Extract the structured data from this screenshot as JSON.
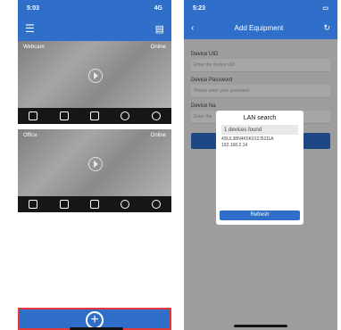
{
  "left": {
    "status_time": "5:03",
    "status_right": "4G",
    "cameras": [
      {
        "name": "Webcam",
        "status": "Online"
      },
      {
        "name": "Office",
        "status": "Online"
      }
    ]
  },
  "right": {
    "status_time": "5:23",
    "title": "Add Equipment",
    "fields": [
      {
        "label": "Device UID",
        "placeholder": "Enter the device UID"
      },
      {
        "label": "Device Password",
        "placeholder": "Please enter your password"
      },
      {
        "label": "Device Na",
        "placeholder": "Enter the"
      }
    ],
    "dialog": {
      "title": "LAN search",
      "found": "1 devices found",
      "device_id": "4SUL38N4K0K012J5111A",
      "device_ip": "192.168.2.14",
      "refresh": "Refresh"
    }
  },
  "colors": {
    "brand_blue": "#2f6fc9",
    "highlight_red": "#e23a3a"
  }
}
